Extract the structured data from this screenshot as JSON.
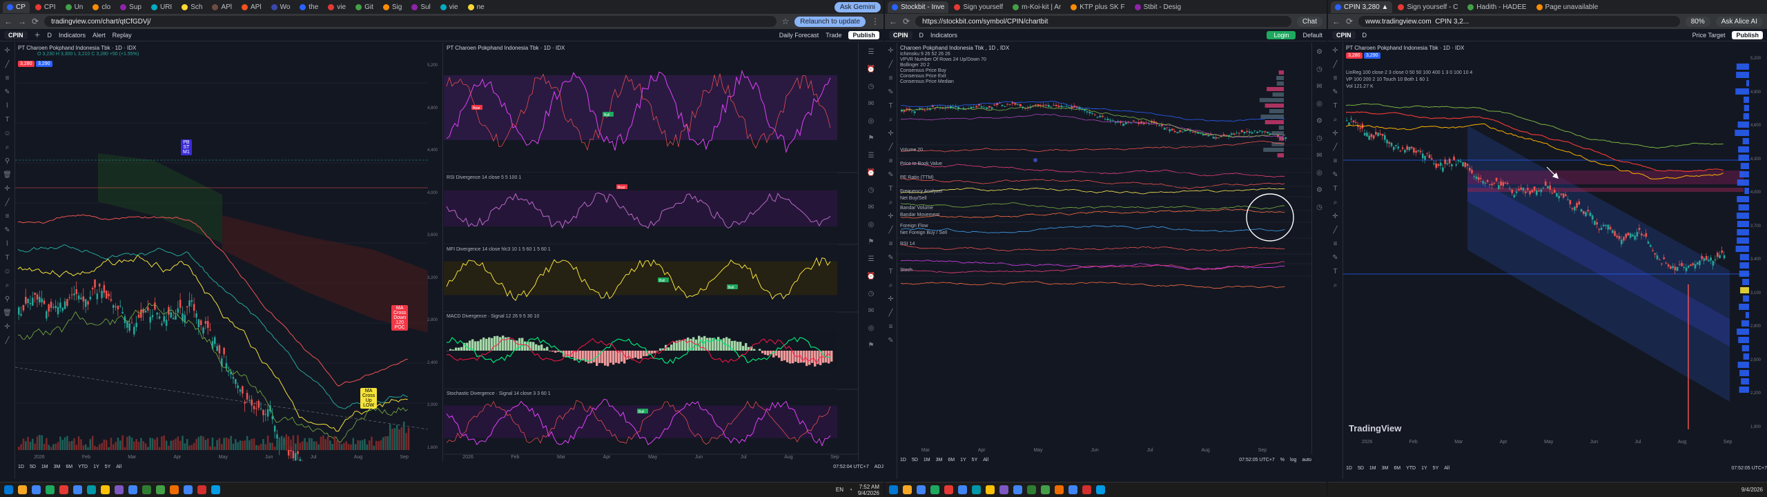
{
  "left": {
    "tabs": [
      "CP",
      "CPI",
      "Un",
      "clo",
      "Sup",
      "URI",
      "Sch",
      "APl",
      "APl",
      "Wo",
      "the",
      "vie",
      "Git",
      "Sig",
      "Sul",
      "vie",
      "ne"
    ],
    "gemini": "Ask Gemini",
    "url": "tradingview.com/chart/qtCfGDVj/",
    "relaunch": "Relaunch to update",
    "symbol": "CPIN",
    "menu": {
      "indicators": "Indicators",
      "alert": "Alert",
      "replay": "Replay",
      "daily": "Daily Forecast",
      "trade": "Trade",
      "publish": "Publish"
    },
    "main_legend": "PT Charoen Pokphand Indonesia Tbk · 1D · IDX",
    "main_ohlc": "O 3,230 H 3,300 L 3,210 C 3,280 +50 (+1.55%)",
    "price_sell": "3,280",
    "price_buy": "3,290",
    "pane2_legend": "PT Charoen Pokphand Indonesia Tbk · 1D · IDX",
    "ind_rsi": "RSI Divergence 14 close 5 5 100 1",
    "ind_mfi": "MFI Divergence 14 close hlc3 10 1 5 60 1 5 60 1",
    "ind_macd": "MACD Divergence · Signal 12 26 9 5 30 10",
    "ind_stoch": "Stochastic Divergence · Signal 14 close 3 3 60 1",
    "labels": {
      "wick": "PB\nST\nM1",
      "sell": "MA\nCross\nDown\n120\nPOC",
      "buy": "MA\nCross\nUp\nLOW",
      "bull": "Bull",
      "bear": "Bear"
    },
    "xlabels": [
      "2026",
      "Feb",
      "Mar",
      "Apr",
      "May",
      "Jun",
      "Jul",
      "Aug",
      "Sep"
    ],
    "ylabels": [
      "5,200",
      "4,800",
      "4,400",
      "4,000",
      "3,600",
      "3,200",
      "2,800",
      "2,400",
      "2,000",
      "1,600"
    ],
    "ranges": [
      "1D",
      "5D",
      "1M",
      "3M",
      "6M",
      "YTD",
      "1Y",
      "5Y",
      "All"
    ],
    "time": "07:52:04 UTC+7",
    "adj": "ADJ",
    "tray": {
      "lang": "EN",
      "time": "7:52 AM",
      "date": "9/4/2026"
    }
  },
  "middle": {
    "tabs": [
      "Stockbit - Inve",
      "Sign yourself",
      "m-Koi-kit | Ar",
      "KTP plus SK F",
      "Stbit - Desig"
    ],
    "url": "https://stockbit.com/symbol/CPIN/chartbit",
    "chat": "Chat",
    "symbol": "CPIN",
    "login": "Login",
    "default": "Default",
    "indicators": "Indicators",
    "legend_main": "Charoen Pokphand Indonesia Tbk , 1D , IDX",
    "legend_lines": [
      "Ichimoku 9 26 52 26 26",
      "VPVR Number Of Rows 24 Up/Down 70",
      "Bollinger 20 2",
      "Consensus Price Buy",
      "Consensus Price Exit",
      "Consensus Price Median"
    ],
    "subpanes": [
      "Volume 20",
      "Price to Book Value",
      "PE Ratio (TTM)",
      "Frequency Analyzer",
      "Net Buy/Sell",
      "Foreign Flow",
      "Net Foreign Buy / Sell",
      "RSI 14",
      "Stoch",
      "Bandar Volume",
      "Bandar Movement"
    ],
    "xlabels": [
      "Mar",
      "Apr",
      "May",
      "Jun",
      "Jul",
      "Aug",
      "Sep"
    ],
    "ranges": [
      "1D",
      "5D",
      "1M",
      "3M",
      "6M",
      "1Y",
      "5Y",
      "All"
    ],
    "time": "07:52:05 UTC+7",
    "pct": "%",
    "log": "log",
    "auto": "auto"
  },
  "right": {
    "tabs": [
      "CPIN 3,280 ▲",
      "Sign yourself - C",
      "Hadith - HADEE",
      "Page unavailable"
    ],
    "url": "www.tradingview.com",
    "title_url": "CPIN 3,2...",
    "zoom": "80%",
    "ask": "Ask Alice AI",
    "symbol": "CPIN",
    "price_target": "Price Target",
    "publish": "Publish",
    "legend": "PT Charoen Pokphand Indonesia Tbk · 1D · IDX",
    "legend2": "LinReg 100 close 2 3 close 0 50 50 100 400 1 3 0 100 10 4",
    "legend3": "VP 100 200 2 10 Touch 10 Both 1 60 1",
    "price_sell": "3,280",
    "price_buy": "3,290",
    "vol_legend": "Vol 121.27 K",
    "watermark": "TradingView",
    "xlabels": [
      "2026",
      "Feb",
      "Mar",
      "Apr",
      "May",
      "Jun",
      "Jul",
      "Aug",
      "Sep"
    ],
    "ylabels": [
      "5,200",
      "4,900",
      "4,600",
      "4,300",
      "4,000",
      "3,700",
      "3,400",
      "3,100",
      "2,800",
      "2,500",
      "2,200",
      "1,900"
    ],
    "ranges": [
      "1D",
      "5D",
      "1M",
      "3M",
      "6M",
      "YTD",
      "1Y",
      "5Y",
      "All"
    ],
    "time": "07:52:05 UTC+7",
    "date": "9/4/2026"
  }
}
